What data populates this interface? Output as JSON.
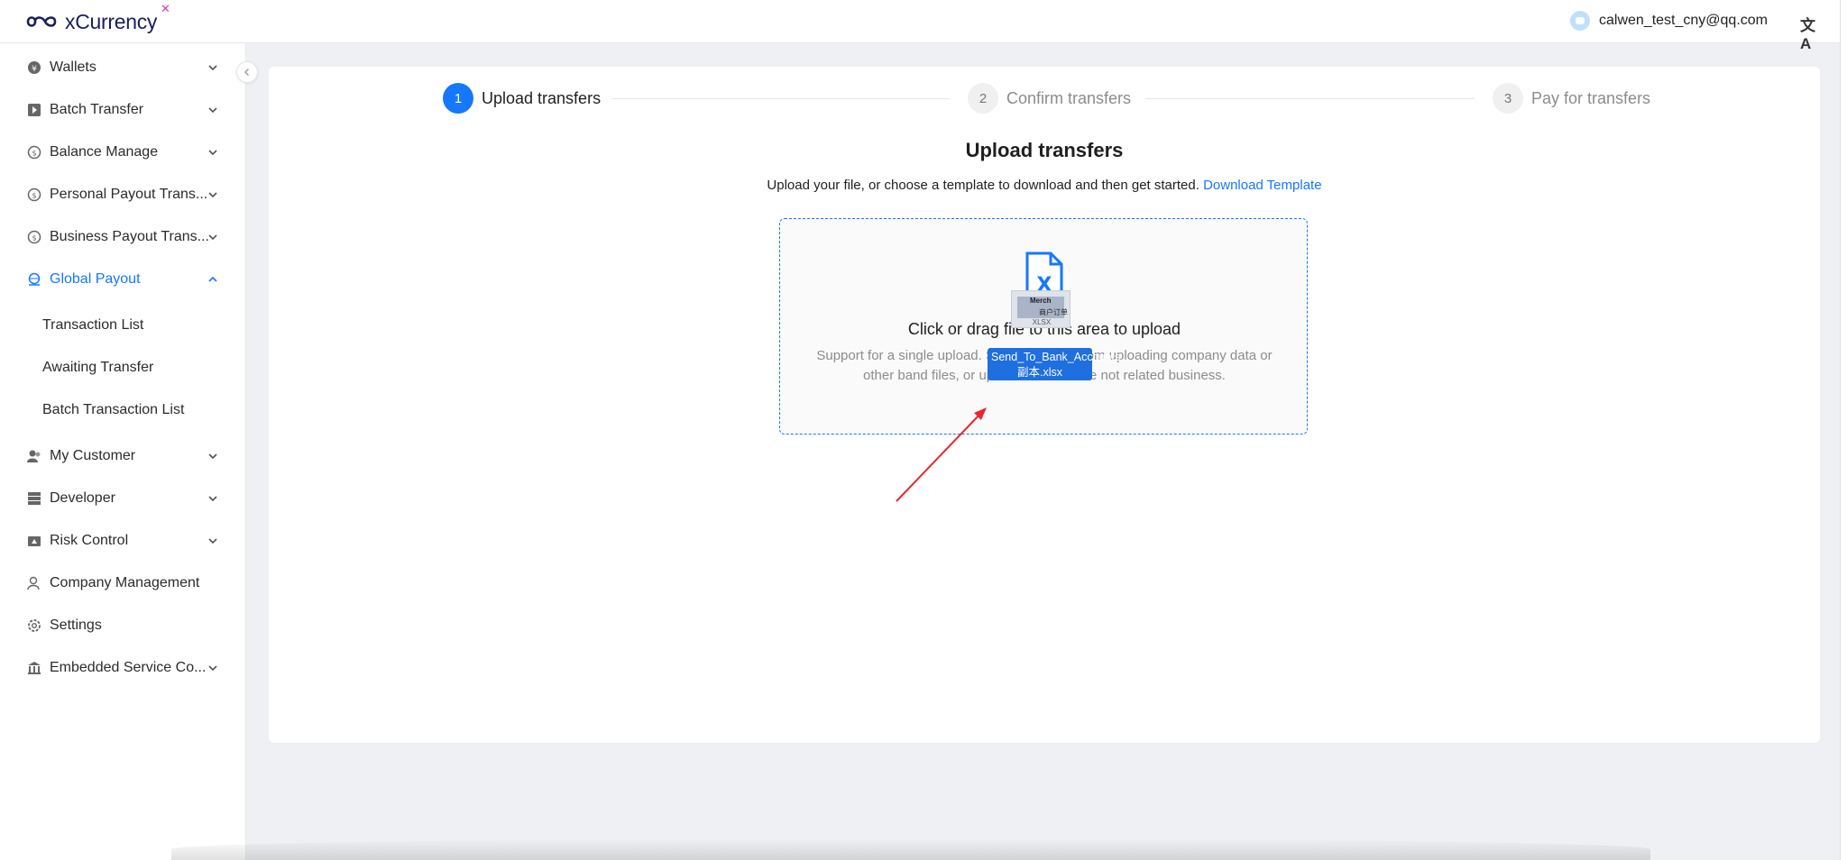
{
  "header": {
    "brand": "xCurrency",
    "brand_mark": "✕",
    "user_email": "calwen_test_cny@qq.com",
    "language_icon": "translate-icon",
    "language_glyph": "文A"
  },
  "sidebar": {
    "items": [
      {
        "label": "Wallets",
        "icon": "wallet-icon"
      },
      {
        "label": "Batch Transfer",
        "icon": "batch-transfer-icon"
      },
      {
        "label": "Balance Manage",
        "icon": "balance-icon"
      },
      {
        "label": "Personal Payout Trans...",
        "icon": "personal-payout-icon"
      },
      {
        "label": "Business Payout Trans...",
        "icon": "business-payout-icon"
      },
      {
        "label": "Global Payout",
        "icon": "global-payout-icon"
      },
      {
        "label": "My Customer",
        "icon": "customer-icon"
      },
      {
        "label": "Developer",
        "icon": "developer-icon"
      },
      {
        "label": "Risk Control",
        "icon": "risk-control-icon"
      },
      {
        "label": "Company Management",
        "icon": "company-icon"
      },
      {
        "label": "Settings",
        "icon": "gear-icon"
      },
      {
        "label": "Embedded Service Co...",
        "icon": "bank-icon"
      }
    ],
    "sub_items": [
      {
        "label": "Transaction List"
      },
      {
        "label": "Awaiting Transfer"
      },
      {
        "label": "Batch Transaction List"
      }
    ],
    "active_color": "#1677ff"
  },
  "steps": [
    {
      "num": "1",
      "label": "Upload transfers",
      "state": "active"
    },
    {
      "num": "2",
      "label": "Confirm transfers",
      "state": "idle"
    },
    {
      "num": "3",
      "label": "Pay for transfers",
      "state": "idle"
    }
  ],
  "main": {
    "title": "Upload transfers",
    "description": "Upload your file, or choose a template to download and then get started.",
    "download_link": "Download Template",
    "drop_title": "Click or drag file to this area to upload",
    "drop_hint": "Support for a single upload. Strictly prohibit from uploading company data or other band files, or upload files that are not related business.",
    "file_icon": "excel-file-icon"
  },
  "drag": {
    "file_name": "Send_To_Bank_Accounts...副本.xlsx",
    "thumb_ext": "XLSX",
    "thumb_title": "Merch",
    "thumb_sub": "商户订单"
  }
}
